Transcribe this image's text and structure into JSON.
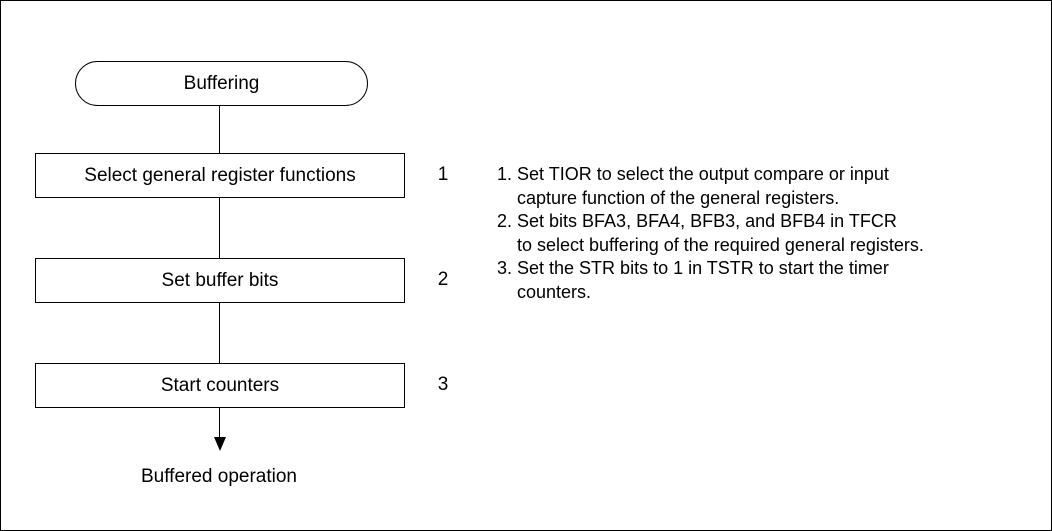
{
  "flowchart": {
    "start": "Buffering",
    "steps": [
      {
        "label": "Select general register functions",
        "number": "1"
      },
      {
        "label": "Set buffer bits",
        "number": "2"
      },
      {
        "label": "Start counters",
        "number": "3"
      }
    ],
    "end": "Buffered operation"
  },
  "notes": [
    "1. Set TIOR to select the output compare or input",
    "    capture function of the general registers.",
    "2. Set bits BFA3, BFA4, BFB3, and BFB4 in TFCR",
    "    to select buffering of the required general registers.",
    "3. Set the STR bits to 1 in TSTR to start the timer",
    "    counters."
  ]
}
